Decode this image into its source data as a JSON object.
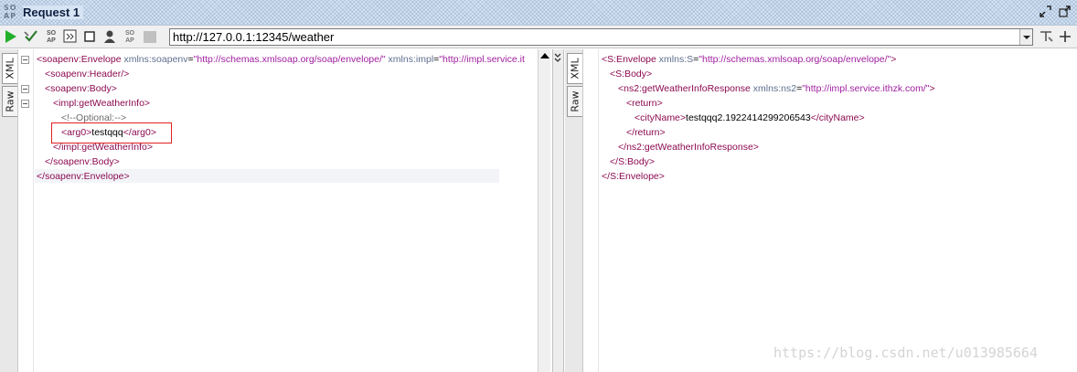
{
  "window": {
    "logo_text": "SO AP",
    "title": "Request 1"
  },
  "toolbar": {
    "url": "http://127.0.0.1:12345/weather",
    "icons": [
      "run-icon",
      "validate-icon",
      "soap-icon",
      "format-icon",
      "stop-icon",
      "user-icon",
      "soap-alt-icon",
      "disabled-icon"
    ]
  },
  "request": {
    "tabs": [
      "XML",
      "Raw"
    ],
    "lines": [
      {
        "indent": 0,
        "fold": true,
        "parts": [
          [
            "t",
            "<"
          ],
          [
            "tn",
            "soapenv:Envelope"
          ],
          [
            "an",
            " xmlns:soapenv"
          ],
          [
            "tx",
            "="
          ],
          [
            "av",
            "\"http://schemas.xmlsoap.org/soap/envelope/\""
          ],
          [
            "an",
            " xmlns:impl"
          ],
          [
            "tx",
            "="
          ],
          [
            "av",
            "\"http://impl.service.it"
          ]
        ]
      },
      {
        "indent": 1,
        "fold": false,
        "parts": [
          [
            "t",
            "<"
          ],
          [
            "tn",
            "soapenv:Header"
          ],
          [
            "t",
            "/>"
          ]
        ]
      },
      {
        "indent": 1,
        "fold": true,
        "parts": [
          [
            "t",
            "<"
          ],
          [
            "tn",
            "soapenv:Body"
          ],
          [
            "t",
            ">"
          ]
        ]
      },
      {
        "indent": 2,
        "fold": true,
        "parts": [
          [
            "t",
            "<"
          ],
          [
            "tn",
            "impl:getWeatherInfo"
          ],
          [
            "t",
            ">"
          ]
        ]
      },
      {
        "indent": 3,
        "fold": false,
        "parts": [
          [
            "cm",
            "<!--Optional:-->"
          ]
        ]
      },
      {
        "indent": 3,
        "fold": false,
        "parts": [
          [
            "t",
            "<"
          ],
          [
            "tn",
            "arg0"
          ],
          [
            "t",
            ">"
          ],
          [
            "tx",
            "testqqq"
          ],
          [
            "t",
            "</"
          ],
          [
            "tn",
            "arg0"
          ],
          [
            "t",
            ">"
          ]
        ]
      },
      {
        "indent": 2,
        "fold": false,
        "parts": [
          [
            "t",
            "</"
          ],
          [
            "tn",
            "impl:getWeatherInfo"
          ],
          [
            "t",
            ">"
          ]
        ]
      },
      {
        "indent": 1,
        "fold": false,
        "parts": [
          [
            "t",
            "</"
          ],
          [
            "tn",
            "soapenv:Body"
          ],
          [
            "t",
            ">"
          ]
        ]
      },
      {
        "indent": 0,
        "fold": false,
        "parts": [
          [
            "t",
            "</"
          ],
          [
            "tn",
            "soapenv:Envelope"
          ],
          [
            "t",
            ">"
          ]
        ]
      }
    ]
  },
  "response": {
    "tabs": [
      "XML",
      "Raw"
    ],
    "lines": [
      {
        "indent": 0,
        "parts": [
          [
            "t",
            "<"
          ],
          [
            "tn",
            "S:Envelope"
          ],
          [
            "an",
            " xmlns:S"
          ],
          [
            "tx",
            "="
          ],
          [
            "av",
            "\"http://schemas.xmlsoap.org/soap/envelope/\""
          ],
          [
            "t",
            ">"
          ]
        ]
      },
      {
        "indent": 1,
        "parts": [
          [
            "t",
            "<"
          ],
          [
            "tn",
            "S:Body"
          ],
          [
            "t",
            ">"
          ]
        ]
      },
      {
        "indent": 2,
        "parts": [
          [
            "t",
            "<"
          ],
          [
            "tn",
            "ns2:getWeatherInfoResponse"
          ],
          [
            "an",
            " xmlns:ns2"
          ],
          [
            "tx",
            "="
          ],
          [
            "av",
            "\"http://impl.service.ithzk.com/\""
          ],
          [
            "t",
            ">"
          ]
        ]
      },
      {
        "indent": 3,
        "parts": [
          [
            "t",
            "<"
          ],
          [
            "tn",
            "return"
          ],
          [
            "t",
            ">"
          ]
        ]
      },
      {
        "indent": 4,
        "parts": [
          [
            "t",
            "<"
          ],
          [
            "tn",
            "cityName"
          ],
          [
            "t",
            ">"
          ],
          [
            "tx",
            "testqqq2.1922414299206543"
          ],
          [
            "t",
            "</"
          ],
          [
            "tn",
            "cityName"
          ],
          [
            "t",
            ">"
          ]
        ]
      },
      {
        "indent": 3,
        "parts": [
          [
            "t",
            "</"
          ],
          [
            "tn",
            "return"
          ],
          [
            "t",
            ">"
          ]
        ]
      },
      {
        "indent": 2,
        "parts": [
          [
            "t",
            "</"
          ],
          [
            "tn",
            "ns2:getWeatherInfoResponse"
          ],
          [
            "t",
            ">"
          ]
        ]
      },
      {
        "indent": 1,
        "parts": [
          [
            "t",
            "</"
          ],
          [
            "tn",
            "S:Body"
          ],
          [
            "t",
            ">"
          ]
        ]
      },
      {
        "indent": 0,
        "parts": [
          [
            "t",
            "</"
          ],
          [
            "tn",
            "S:Envelope"
          ],
          [
            "t",
            ">"
          ]
        ]
      }
    ]
  },
  "watermark": "https://blog.csdn.net/u013985664"
}
